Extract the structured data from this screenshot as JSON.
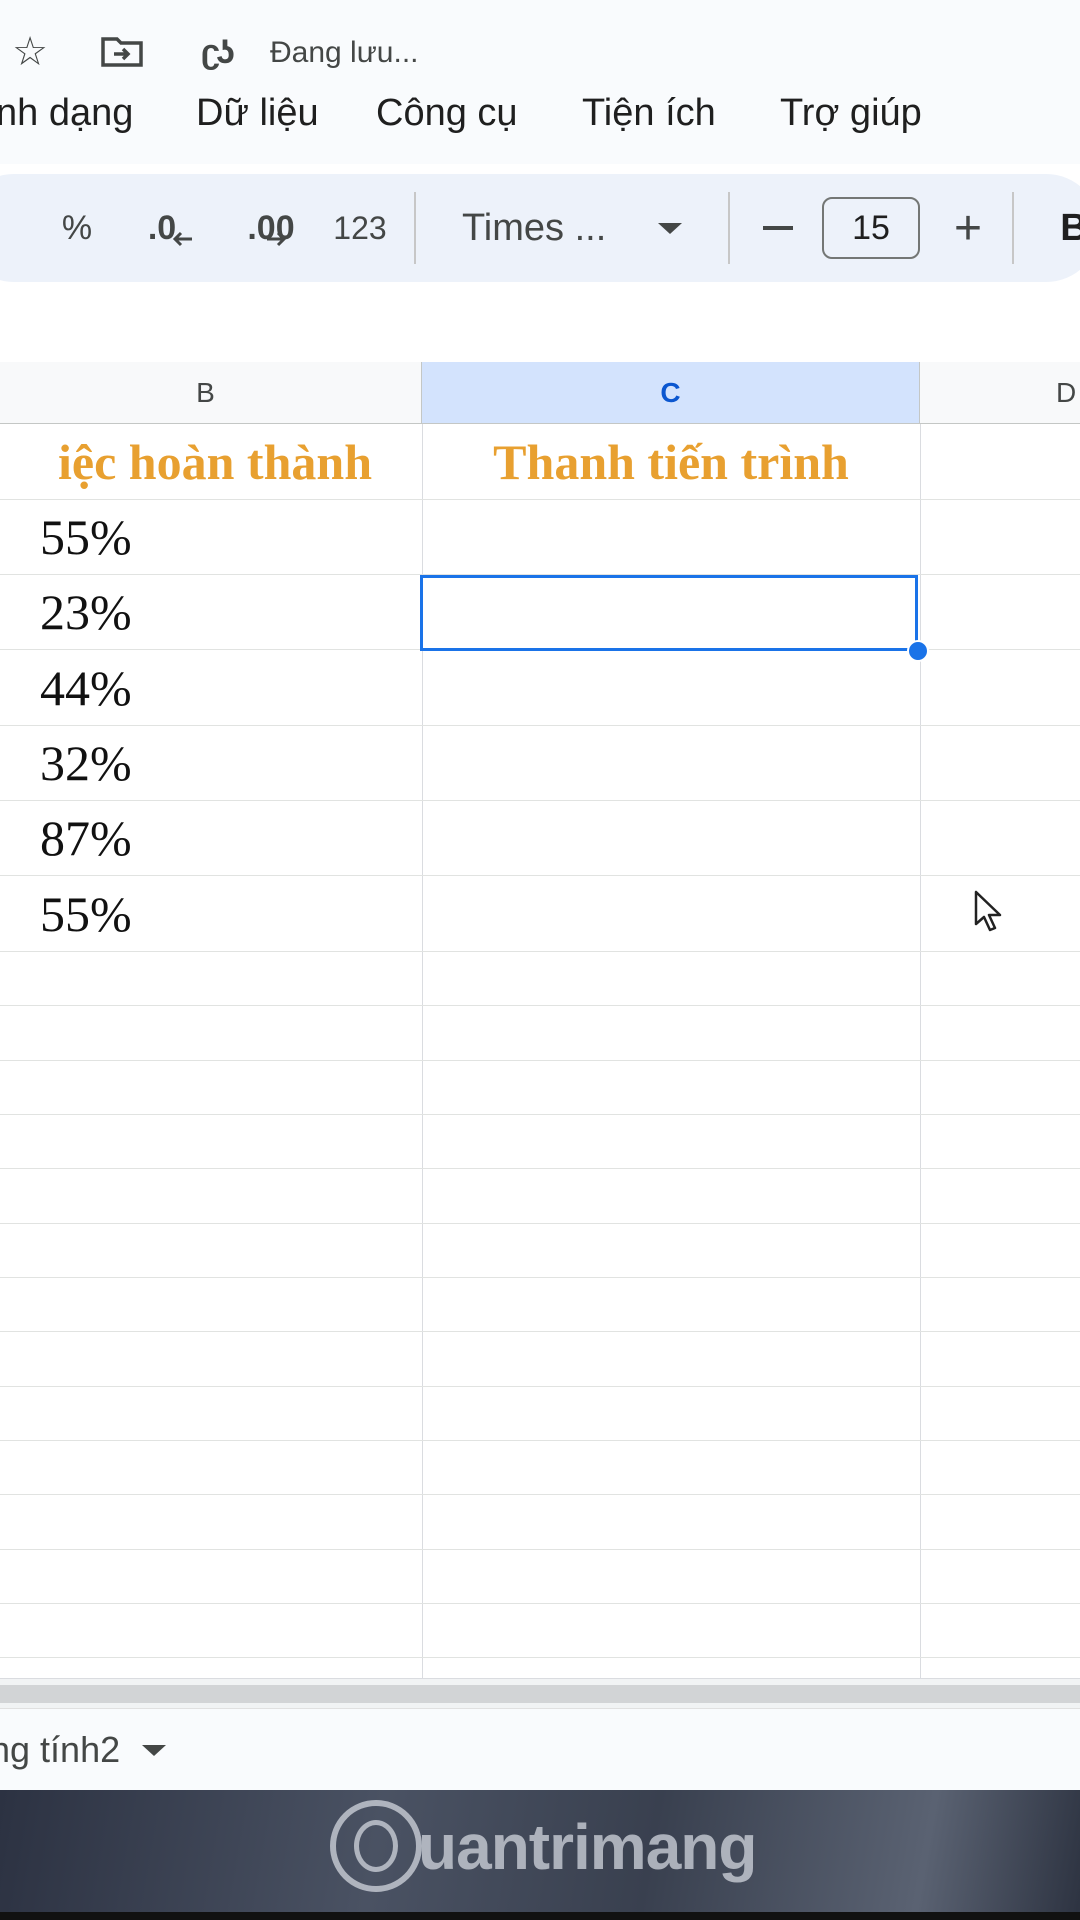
{
  "titlebar": {
    "saving_status": "Đang lưu..."
  },
  "menu": {
    "format": "nh dạng",
    "data": "Dữ liệu",
    "tools": "Công cụ",
    "extensions": "Tiện ích",
    "help": "Trợ giúp"
  },
  "toolbar": {
    "percent": "%",
    "decrease_decimal": ".0",
    "increase_decimal": ".00",
    "number_format": "123",
    "font_name": "Times ...",
    "font_size": "15",
    "bold": "B"
  },
  "grid": {
    "columns": [
      "B",
      "C",
      "D"
    ],
    "selected_column": "C",
    "header_b": "iệc hoàn thành",
    "header_c": "Thanh tiến trình",
    "header_color": "#e8a030",
    "values_b": [
      "55%",
      "23%",
      "44%",
      "32%",
      "87%",
      "55%"
    ],
    "selected_cell": "C3"
  },
  "sheets": {
    "active_tab": "ng tính2"
  },
  "watermark": {
    "text": "uantrimang"
  },
  "colors": {
    "selection": "#1a73e8",
    "selected_column_header": "#d3e3fd"
  }
}
